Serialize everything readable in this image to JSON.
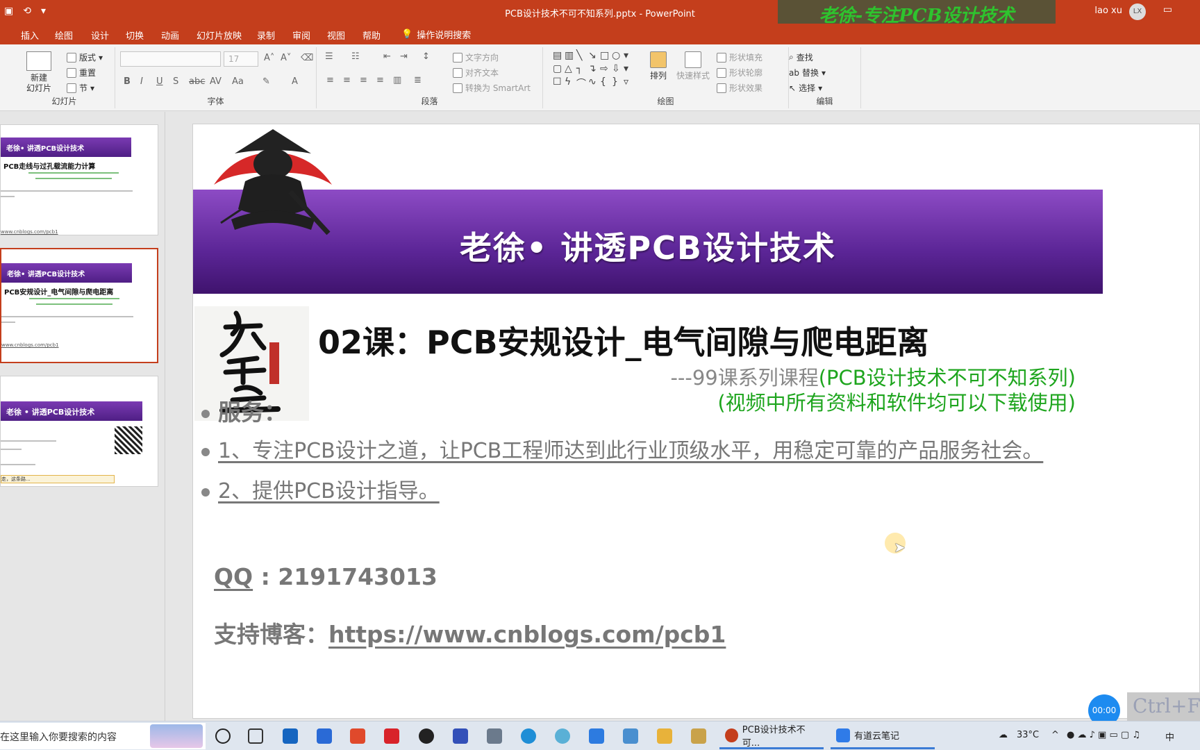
{
  "titlebar": {
    "doc_title": "PCB设计技术不可不知系列.pptx  -  PowerPoint",
    "user": "lao xu",
    "avatar": "LX",
    "watermark": "老徐-专注PCB设计技术"
  },
  "menu": {
    "tabs": [
      "插入",
      "绘图",
      "设计",
      "切换",
      "动画",
      "幻灯片放映",
      "录制",
      "审阅",
      "视图",
      "帮助"
    ],
    "tell_me": "操作说明搜索"
  },
  "ribbon": {
    "slides": {
      "new_slide": "新建\n幻灯片",
      "layout": "版式",
      "reset": "重置",
      "section": "节",
      "label": "幻灯片"
    },
    "font": {
      "size": "17",
      "label": "字体"
    },
    "paragraph": {
      "text_direction": "文字方向",
      "align_text": "对齐文本",
      "smartart": "转换为 SmartArt",
      "label": "段落"
    },
    "drawing": {
      "arrange": "排列",
      "quick_styles": "快速样式",
      "shape_fill": "形状填充",
      "shape_outline": "形状轮廓",
      "shape_effects": "形状效果",
      "label": "绘图"
    },
    "editing": {
      "find": "查找",
      "replace": "替换",
      "select": "选择",
      "label": "编辑"
    }
  },
  "thumbnails": [
    {
      "banner": "老徐• 讲透PCB设计技术",
      "title": "PCB走线与过孔载流能力计算",
      "link": "www.cnblogs.com/pcb1"
    },
    {
      "banner": "老徐• 讲透PCB设计技术",
      "title": "PCB安规设计_电气间隙与爬电距离",
      "link": "www.cnblogs.com/pcb1"
    },
    {
      "banner": "老徐 • 讲透PCB设计技术",
      "footer": "走，这条路..."
    }
  ],
  "slide": {
    "banner_title": "老徐• 讲透PCB设计技术",
    "lesson": "02课：PCB安规设计_电气间隙与爬电距离",
    "series_prefix": "---99课系列课程",
    "series_suffix": "(PCB设计技术不可不知系列)",
    "download_note": "(视频中所有资料和软件均可以下载使用)",
    "service_heading": "服务：",
    "service_1": "1、专注PCB设计之道，让PCB工程师达到此行业顶级水平，用稳定可靠的产品服务社会。",
    "service_2": "2、提供PCB设计指导。",
    "qq_label": "QQ",
    "qq_value": " : 2191743013",
    "blog_label": "支持博客：",
    "blog_url": "https://www.cnblogs.com/pcb1"
  },
  "overlay": {
    "timer": "00:00",
    "ctrl_hint": "Ctrl+F"
  },
  "taskbar": {
    "search_placeholder": "在这里输入你要搜索的内容",
    "app_ppt": "PCB设计技术不可...",
    "app_note": "有道云笔记",
    "temperature": "33°C",
    "ime": "中"
  },
  "colors": {
    "accent": "#c43e1c",
    "banner": "#5b2596",
    "green_text": "#1ea51e"
  }
}
